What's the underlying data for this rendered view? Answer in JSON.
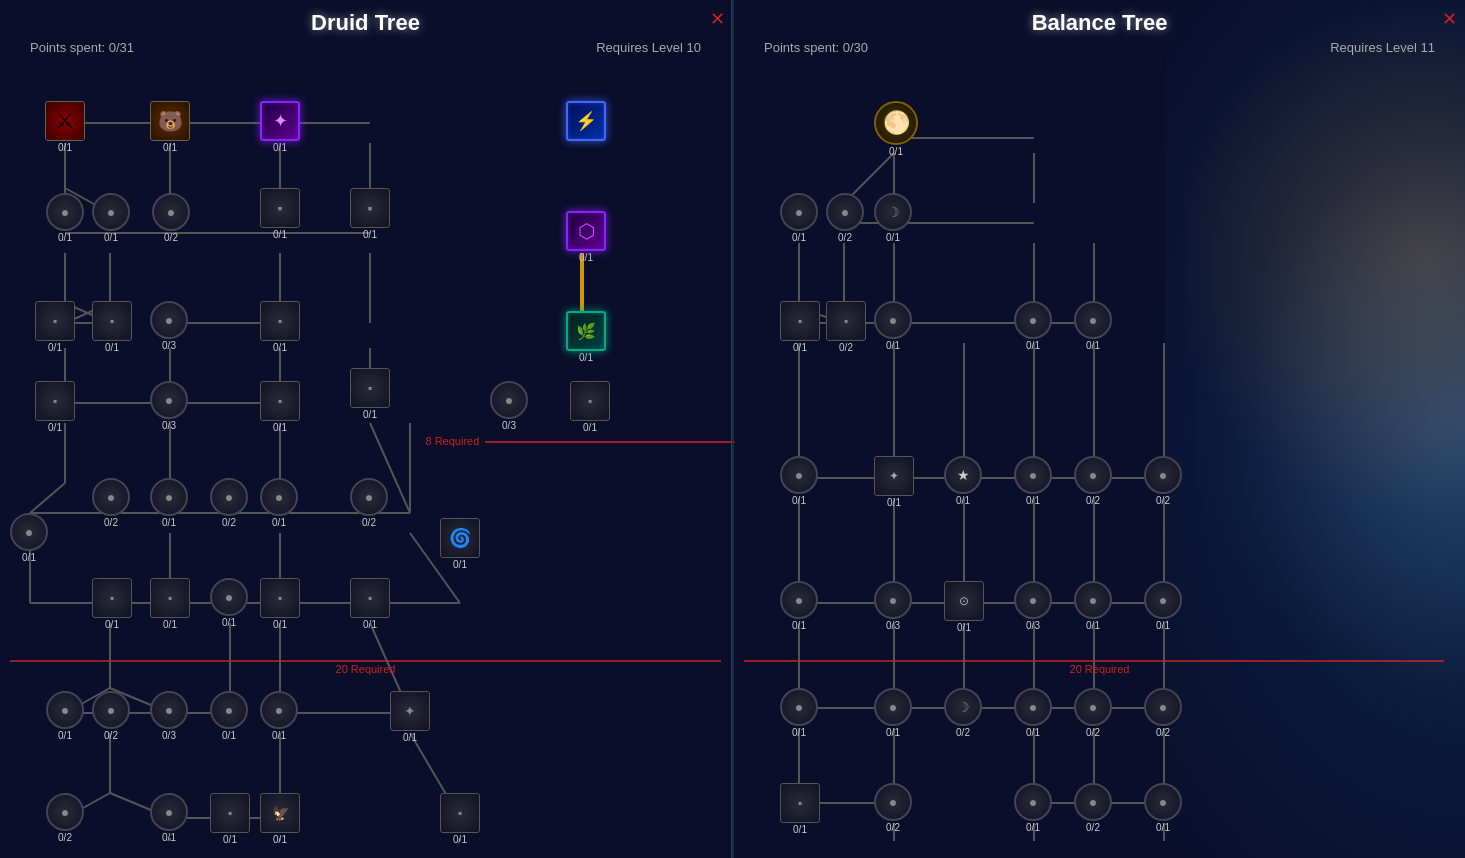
{
  "druid_tree": {
    "title": "Druid Tree",
    "points_spent": "Points spent: 0/31",
    "requires": "Requires Level 10"
  },
  "balance_tree": {
    "title": "Balance Tree",
    "points_spent": "Points spent: 0/30",
    "requires": "Requires Level 11"
  },
  "required_8": "8 Required",
  "required_20": "20 Required"
}
